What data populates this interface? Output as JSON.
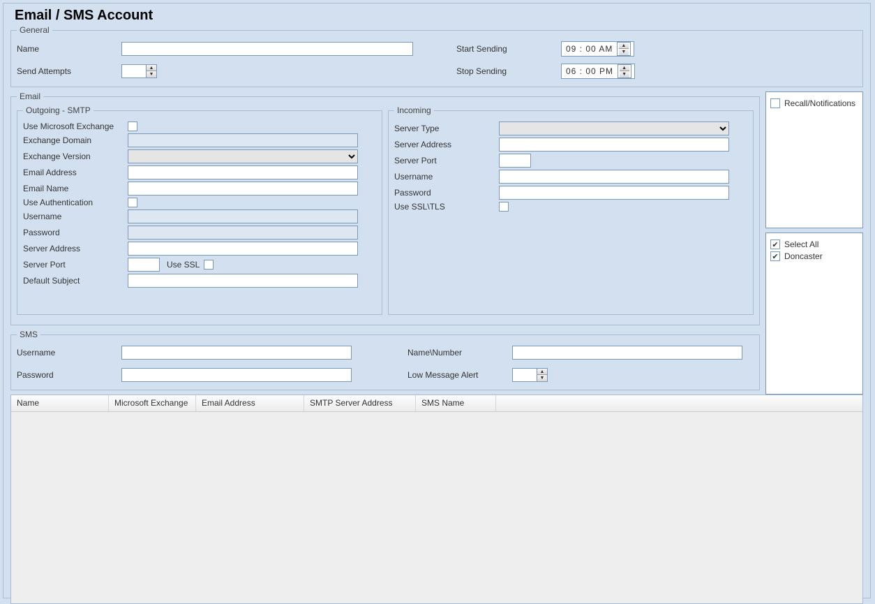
{
  "page_title": "Email / SMS Account",
  "general": {
    "legend": "General",
    "name_label": "Name",
    "send_attempts_label": "Send Attempts",
    "start_sending_label": "Start Sending",
    "stop_sending_label": "Stop Sending",
    "start_time": "09 : 00 AM",
    "stop_time": "06 : 00 PM"
  },
  "email": {
    "legend": "Email",
    "outgoing": {
      "legend": "Outgoing - SMTP",
      "use_ms_exchange_label": "Use Microsoft Exchange",
      "exchange_domain_label": "Exchange Domain",
      "exchange_version_label": "Exchange Version",
      "email_address_label": "Email Address",
      "email_name_label": "Email Name",
      "use_auth_label": "Use Authentication",
      "username_label": "Username",
      "password_label": "Password",
      "server_address_label": "Server Address",
      "server_port_label": "Server Port",
      "use_ssl_label": "Use SSL",
      "default_subject_label": "Default Subject"
    },
    "incoming": {
      "legend": "Incoming",
      "server_type_label": "Server Type",
      "server_address_label": "Server Address",
      "server_port_label": "Server Port",
      "username_label": "Username",
      "password_label": "Password",
      "use_ssl_tls_label": "Use SSL\\TLS"
    }
  },
  "side": {
    "recall_label": "Recall/Notifications",
    "select_all_label": "Select All",
    "location_label": "Doncaster"
  },
  "sms": {
    "legend": "SMS",
    "username_label": "Username",
    "password_label": "Password",
    "name_number_label": "Name\\Number",
    "low_msg_alert_label": "Low Message Alert"
  },
  "table": {
    "headers": [
      "Name",
      "Microsoft Exchange",
      "Email Address",
      "SMTP Server Address",
      "SMS Name"
    ]
  }
}
